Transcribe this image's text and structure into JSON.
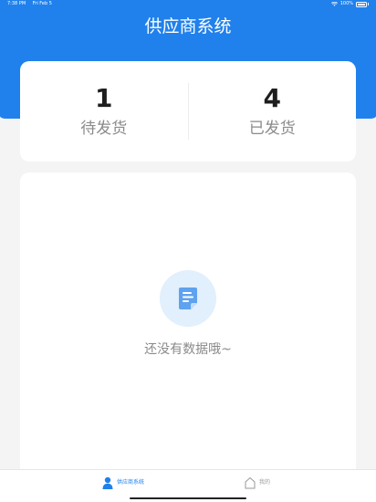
{
  "status_bar": {
    "time": "7:38 PM",
    "date": "Fri Feb 5",
    "battery": "100%"
  },
  "header": {
    "title": "供应商系统"
  },
  "stats": [
    {
      "count": "1",
      "label": "待发货"
    },
    {
      "count": "4",
      "label": "已发货"
    }
  ],
  "empty_state": {
    "icon": "document-icon",
    "message": "还没有数据哦~"
  },
  "tabbar": {
    "items": [
      {
        "label": "供应商系统",
        "icon": "person-icon",
        "active": true
      },
      {
        "label": "我的",
        "icon": "home-icon",
        "active": false
      }
    ]
  },
  "colors": {
    "primary": "#2081ec",
    "background": "#f4f4f4",
    "card": "#ffffff",
    "muted_text": "#8a8a8a"
  }
}
